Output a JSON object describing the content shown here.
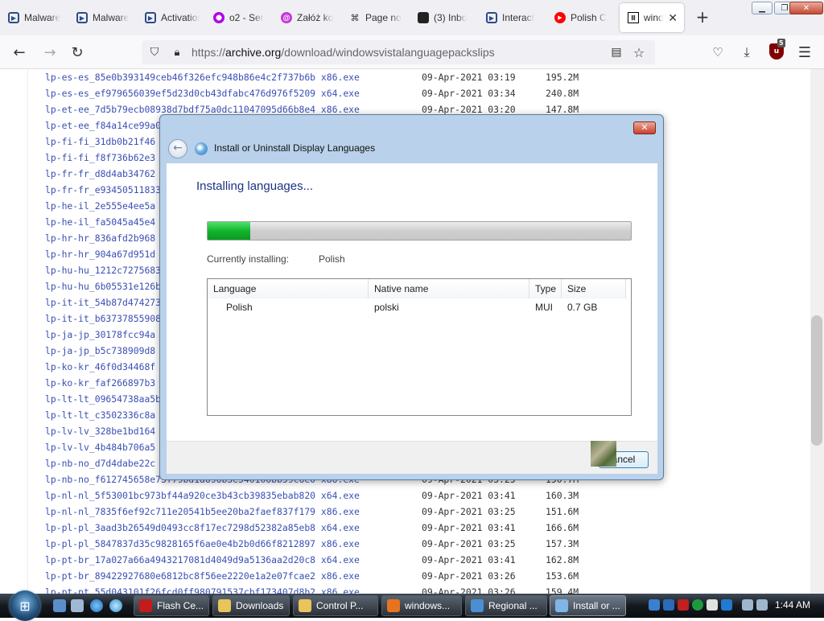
{
  "browser": {
    "tabs": [
      {
        "label": "Malware",
        "icon": "play-icon"
      },
      {
        "label": "Malware",
        "icon": "play-icon"
      },
      {
        "label": "Activation",
        "icon": "play-icon"
      },
      {
        "label": "o2 - Ser",
        "icon": "o2-icon"
      },
      {
        "label": "Załóż ko",
        "icon": "at-icon"
      },
      {
        "label": "Page no",
        "icon": "command-icon"
      },
      {
        "label": "(3) Inbo",
        "icon": "mail-icon"
      },
      {
        "label": "Interact",
        "icon": "play-icon"
      },
      {
        "label": "Polish C",
        "icon": "youtube-icon"
      },
      {
        "label": "windo",
        "icon": "archive-icon",
        "active": true
      }
    ],
    "url": {
      "prefix": "https://",
      "host": "archive.org",
      "path": "/download/windowsvistalanguagepackslips"
    },
    "extension_badge": "5",
    "extension_letter": "u"
  },
  "listing": {
    "rows": [
      {
        "name": "lp-es-es_85e0b393149ceb46f326efc948b86e4c2f737b6b x86.exe",
        "date": "09-Apr-2021 03:19",
        "size": "195.2M"
      },
      {
        "name": "lp-es-es_ef979656039ef5d23d0cb43dfabc476d976f5209 x64.exe",
        "date": "09-Apr-2021 03:34",
        "size": "240.8M"
      },
      {
        "name": "lp-et-ee_7d5b79ecb08938d7bdf75a0dc11047095d66b8e4 x86.exe",
        "date": "09-Apr-2021 03:20",
        "size": "147.8M"
      },
      {
        "name": "lp-et-ee_f84a14ce99a0",
        "date": "",
        "size": ""
      },
      {
        "name": "lp-fi-fi_31db0b21f46",
        "date": "",
        "size": ""
      },
      {
        "name": "lp-fi-fi_f8f736b62e3",
        "date": "",
        "size": ""
      },
      {
        "name": "lp-fr-fr_d8d4ab34762",
        "date": "",
        "size": ""
      },
      {
        "name": "lp-fr-fr_e93450511833",
        "date": "",
        "size": ""
      },
      {
        "name": "lp-he-il_2e555e4ee5a",
        "date": "",
        "size": ""
      },
      {
        "name": "lp-he-il_fa5045a45e4",
        "date": "",
        "size": ""
      },
      {
        "name": "lp-hr-hr_836afd2b968",
        "date": "",
        "size": ""
      },
      {
        "name": "lp-hr-hr_904a67d951d",
        "date": "",
        "size": ""
      },
      {
        "name": "lp-hu-hu_1212c7275683",
        "date": "",
        "size": ""
      },
      {
        "name": "lp-hu-hu_6b05531e126b",
        "date": "",
        "size": ""
      },
      {
        "name": "lp-it-it_54b87d474273",
        "date": "",
        "size": ""
      },
      {
        "name": "lp-it-it_b63737855908",
        "date": "",
        "size": ""
      },
      {
        "name": "lp-ja-jp_30178fcc94a",
        "date": "",
        "size": ""
      },
      {
        "name": "lp-ja-jp_b5c738909d8",
        "date": "",
        "size": ""
      },
      {
        "name": "lp-ko-kr_46f0d34468f",
        "date": "",
        "size": ""
      },
      {
        "name": "lp-ko-kr_faf266897b3",
        "date": "",
        "size": ""
      },
      {
        "name": "lp-lt-lt_09654738aa5b",
        "date": "",
        "size": ""
      },
      {
        "name": "lp-lt-lt_c3502336c8a",
        "date": "",
        "size": ""
      },
      {
        "name": "lp-lv-lv_328be1bd164",
        "date": "",
        "size": ""
      },
      {
        "name": "lp-lv-lv_4b484b706a5",
        "date": "",
        "size": ""
      },
      {
        "name": "lp-nb-no_d7d4dabe22c",
        "date": "",
        "size": ""
      },
      {
        "name": "lp-nb-no_f612745658e73f79bd1a696b3e540106bb59c6e0 x86.exe",
        "date": "09-Apr-2021 03:25",
        "size": "150.7M"
      },
      {
        "name": "lp-nl-nl_5f53001bc973bf44a920ce3b43cb39835ebab820 x64.exe",
        "date": "09-Apr-2021 03:41",
        "size": "160.3M"
      },
      {
        "name": "lp-nl-nl_7835f6ef92c711e20541b5ee20ba2faef837f179 x86.exe",
        "date": "09-Apr-2021 03:25",
        "size": "151.6M"
      },
      {
        "name": "lp-pl-pl_3aad3b26549d0493cc8f17ec7298d52382a85eb8 x64.exe",
        "date": "09-Apr-2021 03:41",
        "size": "166.6M"
      },
      {
        "name": "lp-pl-pl_5847837d35c9828165f6ae0e4b2b0d66f8212897 x86.exe",
        "date": "09-Apr-2021 03:25",
        "size": "157.3M"
      },
      {
        "name": "lp-pt-br_17a027a66a4943217081d4049d9a5136aa2d20c8 x64.exe",
        "date": "09-Apr-2021 03:41",
        "size": "162.8M"
      },
      {
        "name": "lp-pt-br_89422927680e6812bc8f56ee2220e1a2e07fcae2 x86.exe",
        "date": "09-Apr-2021 03:26",
        "size": "153.6M"
      },
      {
        "name": "lp-pt-pt_55d043101f26fcd0ff980791537cbf173407d8b2 x86.exe",
        "date": "09-Apr-2021 03:26",
        "size": "159.4M"
      }
    ]
  },
  "dialog": {
    "title": "Install or Uninstall Display Languages",
    "heading": "Installing languages...",
    "progress": 0.1,
    "current_label": "Currently installing:",
    "current_value": "Polish",
    "table": {
      "headers": [
        "Language",
        "Native name",
        "Type",
        "Size"
      ],
      "rows": [
        {
          "language": "Polish",
          "native": "polski",
          "type": "MUI",
          "size": "0.7 GB"
        }
      ]
    },
    "cancel_label": "ancel"
  },
  "taskbar": {
    "buttons": [
      {
        "label": "Flash Ce...",
        "icon": "flash-icon"
      },
      {
        "label": "Downloads",
        "icon": "folder-icon"
      },
      {
        "label": "Control P...",
        "icon": "folder-icon"
      },
      {
        "label": "windows...",
        "icon": "firefox-icon"
      },
      {
        "label": "Regional ...",
        "icon": "globe-icon"
      },
      {
        "label": "Install or ...",
        "icon": "language-icon",
        "active": true
      }
    ],
    "clock": "1:44 AM"
  }
}
